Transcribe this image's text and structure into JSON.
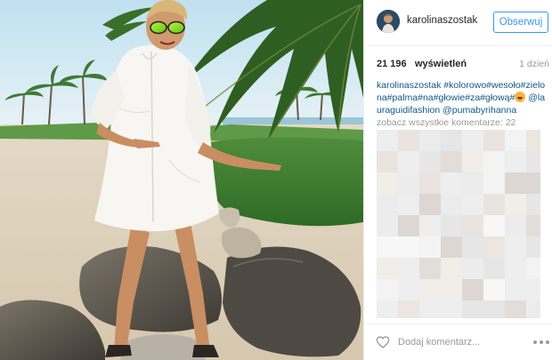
{
  "post": {
    "username": "karolinaszostak",
    "follow_label": "Obserwuj",
    "views_count": "21 196",
    "views_label": "wyświetleń",
    "timestamp": "1 dzień",
    "caption_author": "karolinaszostak",
    "caption_text": "#kolorowo#wesoło#zielona#palma#na#głowie#za#głową#",
    "caption_emoji": "grinning-face-emoji",
    "caption_mentions": "@lauraguidifashion @pumabyrihanna",
    "view_all_label": "zobacz wszystkie komentarze: 22"
  },
  "footer": {
    "comment_placeholder": "Dodaj komentarz..."
  },
  "icons": {
    "like": "heart-icon",
    "more": "more-options-icon",
    "avatar": "avatar"
  },
  "colors": {
    "follow_blue": "#3897f0",
    "link_blue": "#125688",
    "muted_gray": "#999999"
  }
}
